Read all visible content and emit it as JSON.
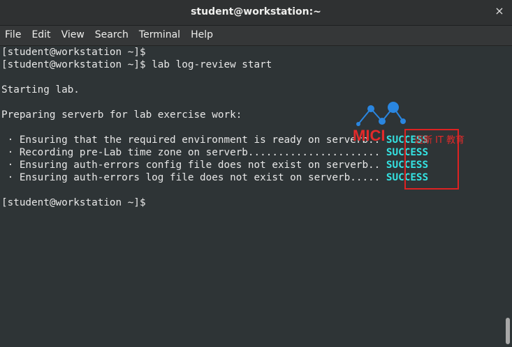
{
  "window": {
    "title": "student@workstation:~",
    "close_glyph": "×"
  },
  "menu": [
    "File",
    "Edit",
    "View",
    "Search",
    "Terminal",
    "Help"
  ],
  "terminal": {
    "lines": [
      "[student@workstation ~]$",
      "[student@workstation ~]$ lab log-review start",
      "",
      "Starting lab.",
      "",
      "Preparing serverb for lab exercise work:",
      ""
    ],
    "tasks": [
      {
        "text": " · Ensuring that the required environment is ready on serverb.. ",
        "status": "SUCCESS"
      },
      {
        "text": " · Recording pre-Lab time zone on serverb...................... ",
        "status": "SUCCESS"
      },
      {
        "text": " · Ensuring auth-errors config file does not exist on serverb.. ",
        "status": "SUCCESS"
      },
      {
        "text": " · Ensuring auth-errors log file does not exist on serverb..... ",
        "status": "SUCCESS"
      }
    ],
    "final_prompt": "[student@workstation ~]$"
  },
  "watermark": {
    "logo_text": "MICI",
    "caption": "迈斯 IT 教育",
    "color": "#e32a2a"
  },
  "colors": {
    "terminal_bg": "#2e3436",
    "text": "#e8e8e8",
    "success": "#34e2e2",
    "highlight": "#dd2222"
  }
}
